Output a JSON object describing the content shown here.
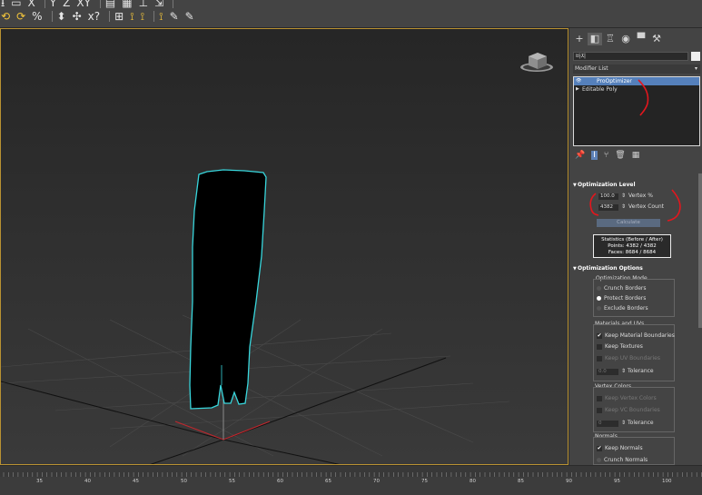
{
  "toolbar": {
    "row1": [
      "⭳",
      "▭",
      "X",
      "Y",
      "Z",
      "XY",
      "▤",
      "▦",
      "⊥",
      "⇲"
    ],
    "row2": [
      "⟲",
      "⟳",
      "%",
      "⬍",
      "✣",
      "x?",
      "⊞",
      "⟟",
      "⟟",
      "⟟",
      "✎",
      "✎"
    ]
  },
  "viewport": {
    "accent_border": "#b99232",
    "object_outline": "#38d6dc"
  },
  "command_panel": {
    "object_name": "바지",
    "modifier_list_label": "Modifier List",
    "stack": [
      {
        "label": "ProOptimizer",
        "selected": true
      },
      {
        "label": "Editable Poly",
        "selected": false
      }
    ]
  },
  "optimization_level": {
    "title": "Optimization Level",
    "vertex_percent_value": "100.0",
    "vertex_percent_label": "Vertex %",
    "vertex_count_value": "4382",
    "vertex_count_label": "Vertex Count",
    "calculate_label": "Calculate",
    "stats_title": "Statistics (Before / After)",
    "stats_points": "Points: 4382 / 4382",
    "stats_faces": "Faces: 8684 / 8684"
  },
  "optimization_options": {
    "title": "Optimization Options",
    "mode_label": "Optimization Mode",
    "modes": [
      {
        "label": "Crunch Borders",
        "on": false
      },
      {
        "label": "Protect Borders",
        "on": true
      },
      {
        "label": "Exclude Borders",
        "on": false
      }
    ],
    "materials_label": "Materials and UVs",
    "keep_material_boundaries": "Keep Material Boundaries",
    "keep_textures": "Keep Textures",
    "keep_uv_boundaries": "Keep UV Boundaries",
    "uv_tolerance_value": "0.0",
    "tolerance_label": "Tolerance",
    "vertex_colors_label": "Vertex Colors",
    "keep_vertex_colors": "Keep Vertex Colors",
    "keep_vc_boundaries": "Keep VC Boundaries",
    "vc_tolerance_value": "0",
    "normals_label": "Normals",
    "keep_normals": "Keep Normals",
    "crunch_normals": "Crunch Normals"
  },
  "timeline": {
    "ticks": [
      "35",
      "40",
      "45",
      "50",
      "55",
      "60",
      "65",
      "70",
      "75",
      "80",
      "85",
      "90",
      "95",
      "100"
    ]
  }
}
